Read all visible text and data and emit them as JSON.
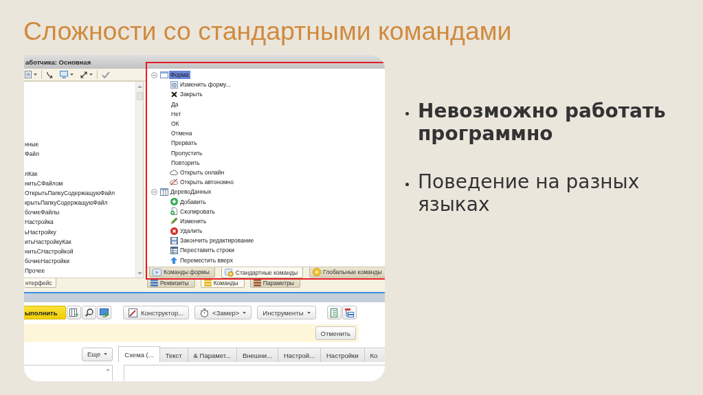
{
  "title": "Сложности со стандартными командами",
  "screenshot": {
    "window_title": "аботчика: Основная",
    "left_list": [
      {
        "label": "нные",
        "selected": false
      },
      {
        "label": "Файл",
        "selected": false
      },
      {
        "label": "лКак",
        "selected": false
      },
      {
        "label": "нитьСФайлом",
        "selected": false
      },
      {
        "label": "ОткрытьПапкуСодержащуюФайл",
        "selected": false
      },
      {
        "label": "крытьПапкуСодержащуюФайл",
        "selected": false
      },
      {
        "label": "бочиеФайлы",
        "selected": false
      },
      {
        "label": "Настройка",
        "selected": false
      },
      {
        "label": "ьНастройку",
        "selected": false
      },
      {
        "label": "итьНастройкуКак",
        "selected": false
      },
      {
        "label": "нитьСНастройкой",
        "selected": false
      },
      {
        "label": "бочиеНастройки",
        "selected": false
      },
      {
        "label": "Прочее",
        "selected": false
      }
    ],
    "left_tabs": [
      {
        "label": "нтерфейс",
        "selected": true
      }
    ],
    "tree": [
      {
        "label": "Форма",
        "kind": "form",
        "expanded": true,
        "selected": true,
        "children": [
          {
            "label": "Изменить форму...",
            "kind": "edit-form",
            "selected": false
          },
          {
            "label": "Закрыть",
            "kind": "close",
            "selected": false
          },
          {
            "label": "Да",
            "kind": "plain",
            "selected": false
          },
          {
            "label": "Нет",
            "kind": "plain",
            "selected": false
          },
          {
            "label": "ОК",
            "kind": "plain",
            "selected": false
          },
          {
            "label": "Отмена",
            "kind": "plain",
            "selected": false
          },
          {
            "label": "Прервать",
            "kind": "plain",
            "selected": false
          },
          {
            "label": "Пропустить",
            "kind": "plain",
            "selected": false
          },
          {
            "label": "Повторить",
            "kind": "plain",
            "selected": false
          },
          {
            "label": "Открыть онлайн",
            "kind": "cloud",
            "selected": false
          },
          {
            "label": "Открыть автономно",
            "kind": "cloud-off",
            "selected": false
          }
        ]
      },
      {
        "label": "ДеревоДанных",
        "kind": "table",
        "expanded": true,
        "selected": false,
        "children": [
          {
            "label": "Добавить",
            "kind": "add",
            "selected": false
          },
          {
            "label": "Скопировать",
            "kind": "copy",
            "selected": false
          },
          {
            "label": "Изменить",
            "kind": "edit",
            "selected": false
          },
          {
            "label": "Удалить",
            "kind": "delete",
            "selected": false
          },
          {
            "label": "Закончить редактирование",
            "kind": "save",
            "selected": false
          },
          {
            "label": "Переставить строки",
            "kind": "rows",
            "selected": false
          },
          {
            "label": "Переместить вверх",
            "kind": "up",
            "selected": false
          }
        ]
      }
    ],
    "tree_tabs": [
      {
        "label": "Команды формы",
        "kind": "window",
        "selected": false
      },
      {
        "label": "Стандартные команды",
        "kind": "gear",
        "selected": true
      },
      {
        "label": "Глобальные команды",
        "kind": "play",
        "selected": false
      }
    ],
    "panel_tabs": [
      {
        "label": "Реквизиты",
        "color": "#4f7fc0",
        "selected": false
      },
      {
        "label": "Команды",
        "color": "#e8b820",
        "selected": true
      },
      {
        "label": "Параметры",
        "color": "#a0603a",
        "selected": false
      }
    ],
    "toolbar": {
      "run": "ыполнить",
      "constructor": "Конструктор...",
      "measure": "<Замер>",
      "tools": "Инструменты"
    },
    "cancel": "Отменить",
    "more": "Еще",
    "editor_tabs": [
      {
        "label": "Схема (...",
        "selected": true
      },
      {
        "label": "Текст",
        "selected": false
      },
      {
        "label": "& Парамет...",
        "selected": false
      },
      {
        "label": "Внешни...",
        "selected": false
      },
      {
        "label": "Настрой...",
        "selected": false
      },
      {
        "label": "Настройки",
        "selected": false
      },
      {
        "label": "Ко",
        "selected": false
      }
    ]
  },
  "bullets": [
    {
      "text": "Невозможно работать программно",
      "bold": true
    },
    {
      "text": "Поведение на разных языках",
      "bold": false
    }
  ]
}
